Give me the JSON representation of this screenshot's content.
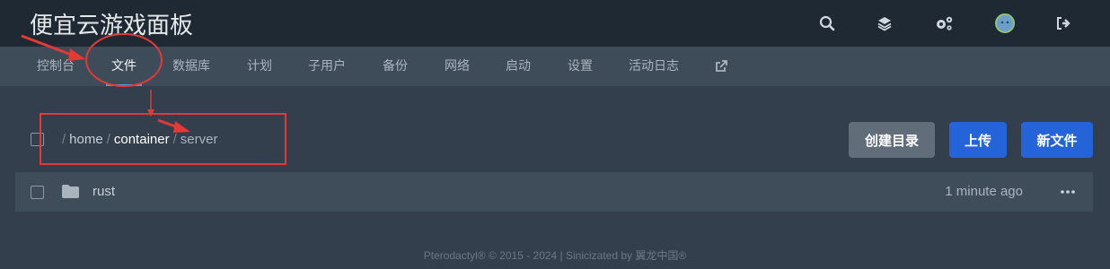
{
  "header": {
    "title": "便宜云游戏面板",
    "icons": [
      "search-icon",
      "layers-icon",
      "cogs-icon",
      "avatar",
      "logout-icon"
    ]
  },
  "nav": {
    "tabs": [
      {
        "label": "控制台"
      },
      {
        "label": "文件",
        "active": true
      },
      {
        "label": "数据库"
      },
      {
        "label": "计划"
      },
      {
        "label": "子用户"
      },
      {
        "label": "备份"
      },
      {
        "label": "网络"
      },
      {
        "label": "启动"
      },
      {
        "label": "设置"
      },
      {
        "label": "活动日志"
      }
    ],
    "external_icon": "external-link-icon"
  },
  "breadcrumb": {
    "segments": [
      "home",
      "container",
      "server"
    ]
  },
  "actions": {
    "create_dir": "创建目录",
    "upload": "上传",
    "new_file": "新文件"
  },
  "files": [
    {
      "name": "rust",
      "modified": "1 minute ago",
      "icon": "folder-icon"
    }
  ],
  "footer": {
    "text": "Pterodactyl® © 2015 - 2024 | Sinicizated by 翼龙中国®"
  },
  "colors": {
    "topbar": "#1f2933",
    "subnav": "#3e4c5a",
    "page": "#333f4d",
    "accent": "#2563d9",
    "annotation": "#e53935"
  }
}
